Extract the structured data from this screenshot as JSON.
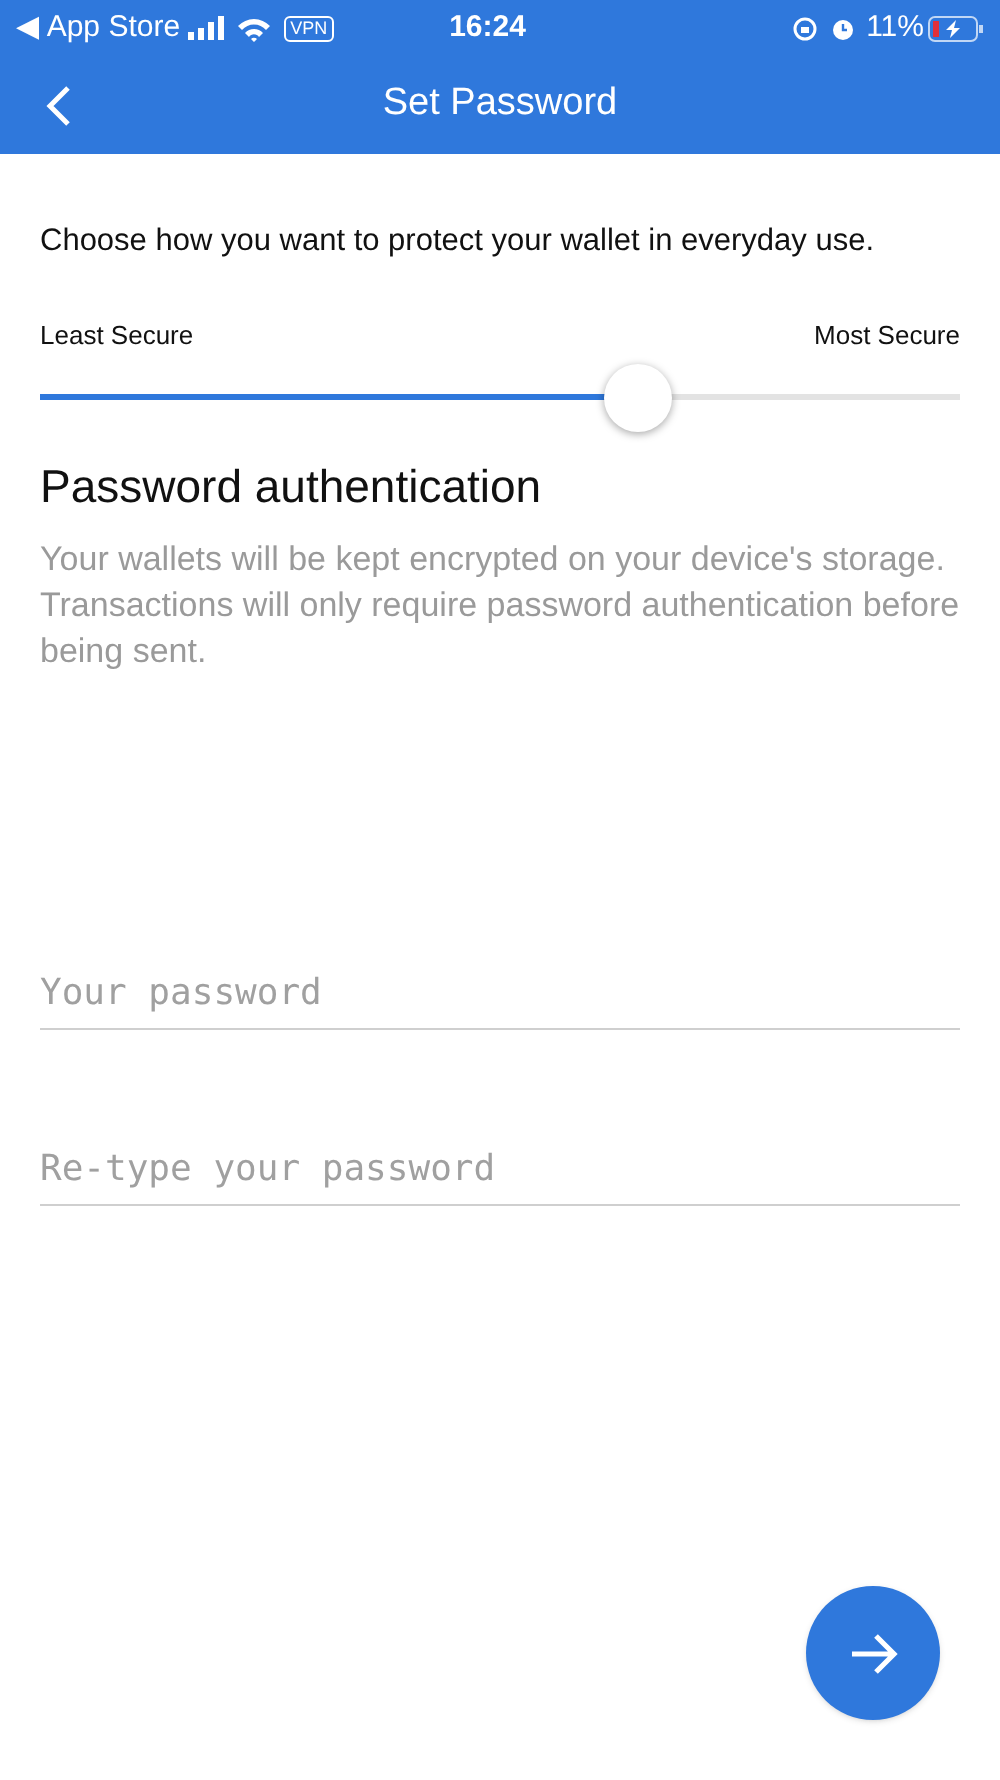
{
  "status_bar": {
    "back_label": "◀ App Store",
    "vpn": "VPN",
    "time": "16:24",
    "battery": "11%"
  },
  "header": {
    "title": "Set Password"
  },
  "intro": "Choose how you want to protect your wallet in everyday use.",
  "security_slider": {
    "min_label": "Least Secure",
    "max_label": "Most Secure",
    "level": 0.65
  },
  "section": {
    "title": "Password authentication",
    "description": "Your wallets will be kept encrypted on your device's storage. Transactions will only require password authentication before being sent."
  },
  "fields": [
    {
      "placeholder": "Your password"
    },
    {
      "placeholder": "Re-type your password"
    }
  ]
}
